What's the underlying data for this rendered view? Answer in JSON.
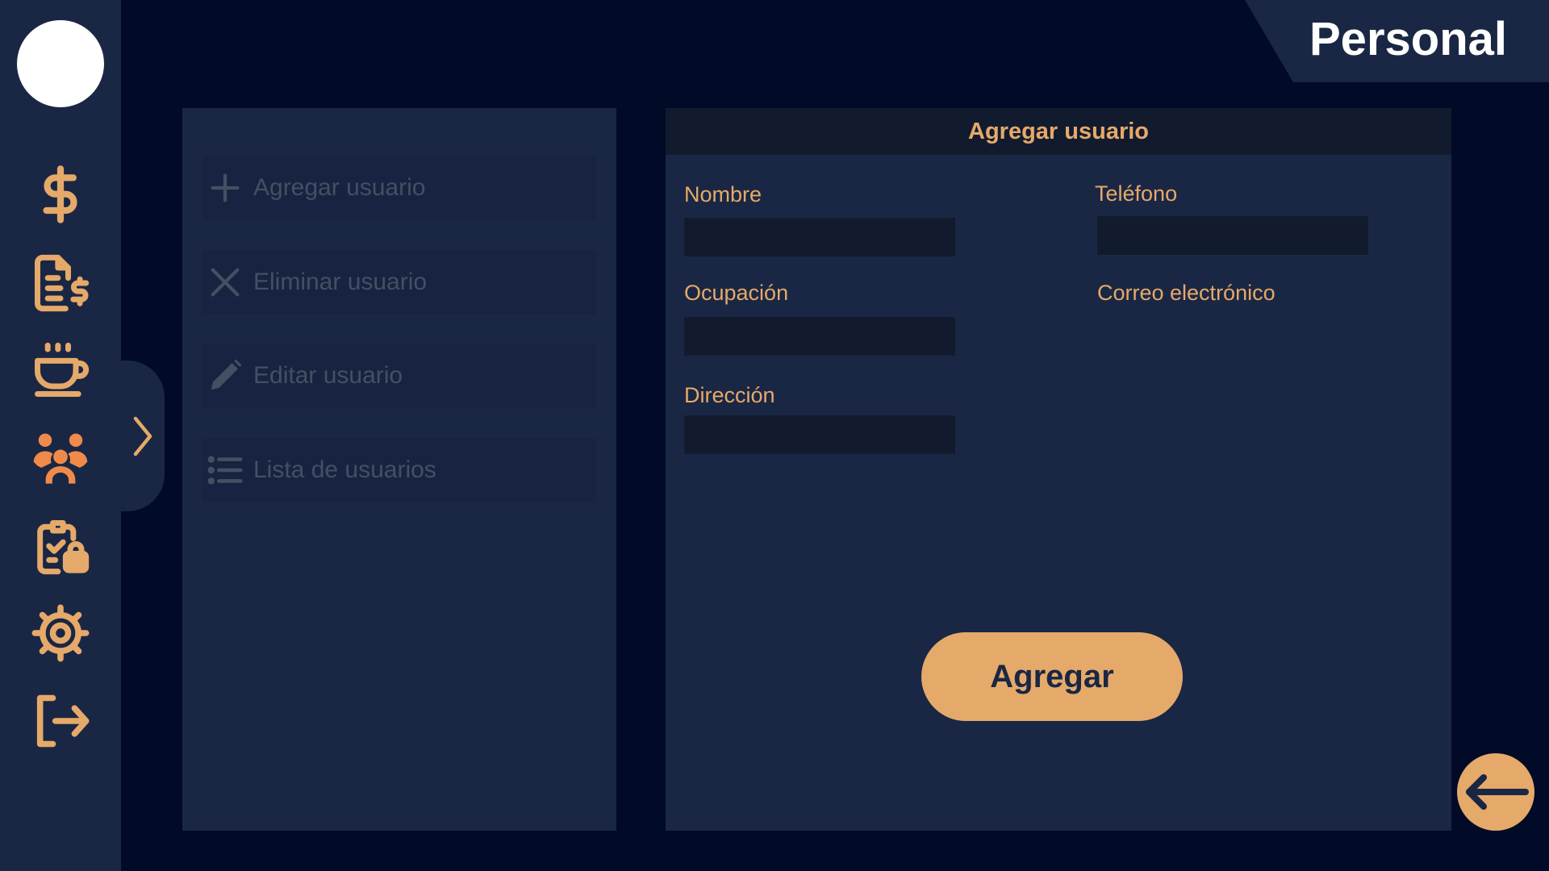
{
  "header": {
    "title": "Personal"
  },
  "sidebar": {
    "items": [
      {
        "icon": "dollar-icon"
      },
      {
        "icon": "invoice-icon"
      },
      {
        "icon": "coffee-icon"
      },
      {
        "icon": "team-icon",
        "active": true
      },
      {
        "icon": "clipboard-lock-icon"
      },
      {
        "icon": "settings-icon"
      },
      {
        "icon": "logout-icon"
      }
    ]
  },
  "menu": {
    "items": [
      {
        "label": "Agregar usuario",
        "icon": "plus-icon"
      },
      {
        "label": "Eliminar usuario",
        "icon": "close-icon"
      },
      {
        "label": "Editar usuario",
        "icon": "pencil-icon"
      },
      {
        "label": "Lista de usuarios",
        "icon": "list-icon"
      }
    ]
  },
  "form": {
    "title": "Agregar usuario",
    "fields": {
      "nombre": {
        "label": "Nombre",
        "value": ""
      },
      "telefono": {
        "label": "Teléfono",
        "value": ""
      },
      "ocupacion": {
        "label": "Ocupación",
        "value": ""
      },
      "correo": {
        "label": "Correo electrónico"
      },
      "direccion": {
        "label": "Dirección",
        "value": ""
      }
    },
    "submit_label": "Agregar"
  },
  "colors": {
    "background": "#010a26",
    "panel": "#1a2744",
    "accent": "#e5a96a",
    "active_icon": "#f08a4b",
    "muted_text": "#454f62"
  }
}
